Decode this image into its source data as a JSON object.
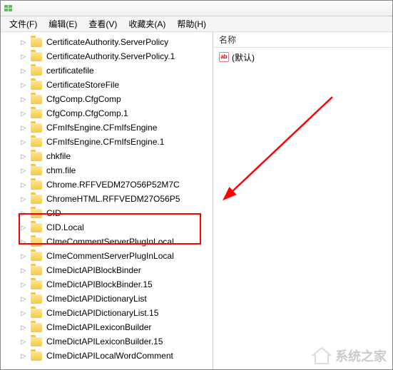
{
  "titlebar": {
    "title": ""
  },
  "menubar": {
    "items": [
      {
        "label": "文件(F)"
      },
      {
        "label": "编辑(E)"
      },
      {
        "label": "查看(V)"
      },
      {
        "label": "收藏夹(A)"
      },
      {
        "label": "帮助(H)"
      }
    ]
  },
  "rightPane": {
    "header": "名称",
    "defaultItem": "(默认)"
  },
  "tree": {
    "items": [
      {
        "label": "CertificateAuthority.ServerPolicy"
      },
      {
        "label": "CertificateAuthority.ServerPolicy.1"
      },
      {
        "label": "certificatefile"
      },
      {
        "label": "CertificateStoreFile"
      },
      {
        "label": "CfgComp.CfgComp"
      },
      {
        "label": "CfgComp.CfgComp.1"
      },
      {
        "label": "CFmIfsEngine.CFmIfsEngine"
      },
      {
        "label": "CFmIfsEngine.CFmIfsEngine.1"
      },
      {
        "label": "chkfile"
      },
      {
        "label": "chm.file"
      },
      {
        "label": "Chrome.RFFVEDM27O56P52M7C"
      },
      {
        "label": "ChromeHTML.RFFVEDM27O56P5"
      },
      {
        "label": "CID"
      },
      {
        "label": "CID.Local"
      },
      {
        "label": "CImeCommentServerPlugInLocal"
      },
      {
        "label": "CImeCommentServerPlugInLocal"
      },
      {
        "label": "CImeDictAPIBlockBinder"
      },
      {
        "label": "CImeDictAPIBlockBinder.15"
      },
      {
        "label": "CImeDictAPIDictionaryList"
      },
      {
        "label": "CImeDictAPIDictionaryList.15"
      },
      {
        "label": "CImeDictAPILexiconBuilder"
      },
      {
        "label": "CImeDictAPILexiconBuilder.15"
      },
      {
        "label": "CImeDictAPILocalWordComment"
      }
    ]
  },
  "watermark": {
    "text": "系统之家"
  }
}
